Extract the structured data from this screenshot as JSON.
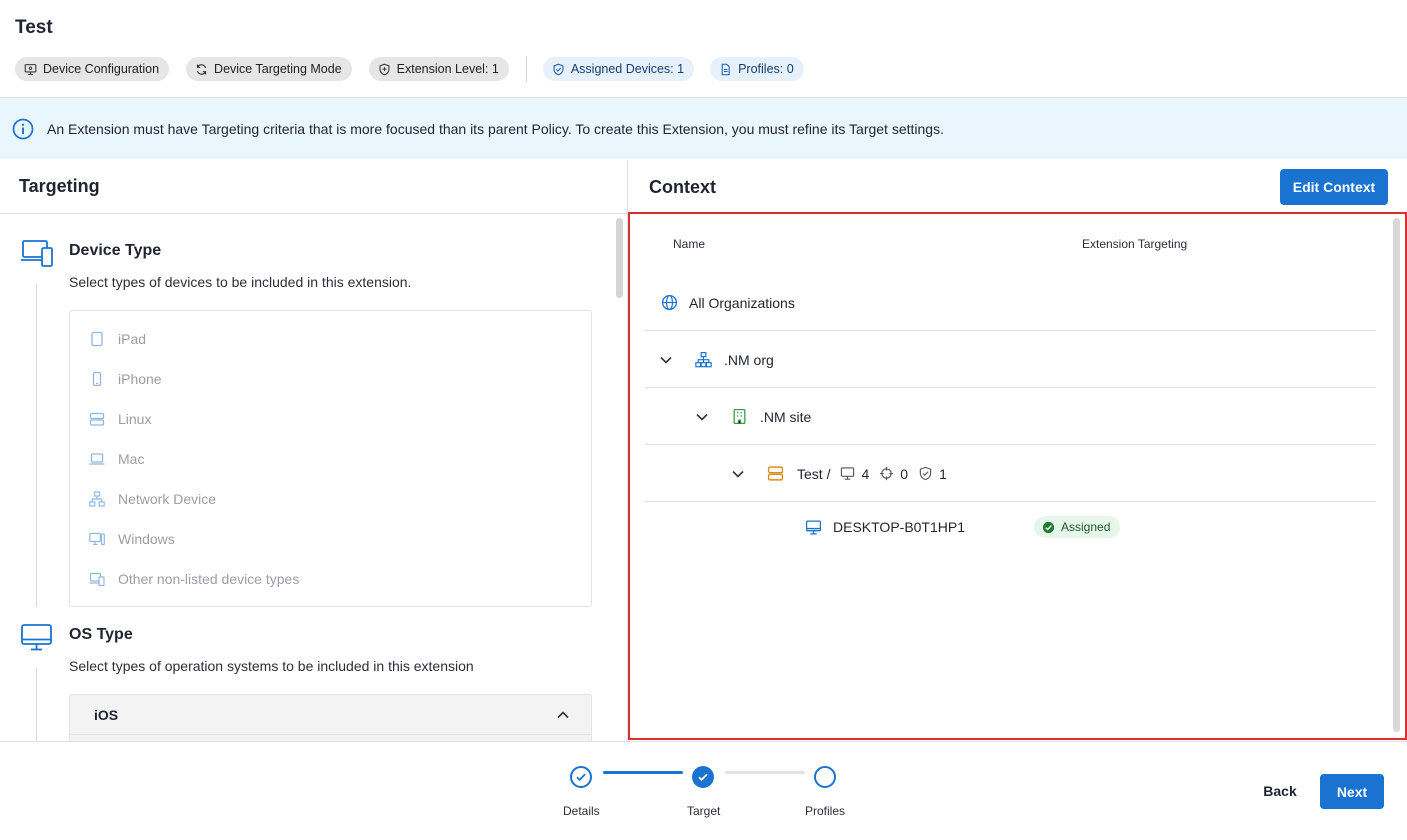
{
  "page": {
    "title": "Test"
  },
  "chips": {
    "device_configuration": "Device Configuration",
    "device_targeting_mode": "Device Targeting Mode",
    "extension_level": "Extension Level: 1",
    "assigned_devices": "Assigned Devices: 1",
    "profiles": "Profiles: 0"
  },
  "banner": {
    "text": "An Extension must have Targeting criteria that is more focused than its parent Policy. To create this Extension, you must refine its Target settings."
  },
  "targeting": {
    "title": "Targeting",
    "device_type": {
      "title": "Device Type",
      "description": "Select types of devices to be included in this extension.",
      "options": [
        {
          "label": "iPad",
          "icon": "tablet-icon"
        },
        {
          "label": "iPhone",
          "icon": "phone-icon"
        },
        {
          "label": "Linux",
          "icon": "server-icon"
        },
        {
          "label": "Mac",
          "icon": "laptop-icon"
        },
        {
          "label": "Network Device",
          "icon": "network-icon"
        },
        {
          "label": "Windows",
          "icon": "desktop-icon"
        },
        {
          "label": "Other non-listed device types",
          "icon": "devices-icon"
        }
      ]
    },
    "os_type": {
      "title": "OS Type",
      "description": "Select types of operation systems to be included in this extension",
      "expanded_group": "iOS"
    }
  },
  "context": {
    "title": "Context",
    "edit_button": "Edit Context",
    "columns": {
      "name": "Name",
      "targeting": "Extension Targeting"
    },
    "tree": {
      "root": "All Organizations",
      "org": ".NM org",
      "site": ".NM site",
      "group": {
        "name": "Test /",
        "devices": "4",
        "targets": "0",
        "policies": "1"
      },
      "device": {
        "name": "DESKTOP-B0T1HP1",
        "status": "Assigned"
      }
    }
  },
  "stepper": {
    "steps": [
      {
        "label": "Details",
        "state": "done"
      },
      {
        "label": "Target",
        "state": "current"
      },
      {
        "label": "Profiles",
        "state": "todo"
      }
    ]
  },
  "footer": {
    "back": "Back",
    "next": "Next"
  },
  "colors": {
    "accent": "#1a73d1",
    "highlight_border": "#d9302b",
    "assigned_bg": "#e6f6ea",
    "banner_bg": "#eaf6fd"
  }
}
